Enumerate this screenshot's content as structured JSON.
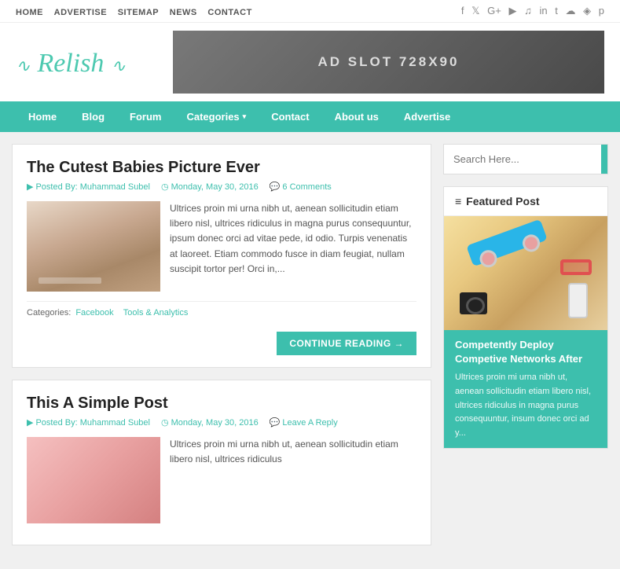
{
  "topNav": {
    "items": [
      "HOME",
      "ADVERTISE",
      "SITEMAP",
      "NEWS",
      "CONTACT"
    ]
  },
  "socialIcons": [
    "f",
    "y",
    "G+",
    "▶",
    "☁",
    "in",
    "t",
    "☁",
    "📷",
    "p"
  ],
  "logo": {
    "text": "Relish",
    "prefix": "~",
    "suffix": "~"
  },
  "adSlot": {
    "text": "AD SLOT 728X90"
  },
  "mainNav": {
    "items": [
      {
        "label": "Home",
        "hasDropdown": false
      },
      {
        "label": "Blog",
        "hasDropdown": false
      },
      {
        "label": "Forum",
        "hasDropdown": false
      },
      {
        "label": "Categories",
        "hasDropdown": true
      },
      {
        "label": "Contact",
        "hasDropdown": false
      },
      {
        "label": "About us",
        "hasDropdown": false
      },
      {
        "label": "Advertise",
        "hasDropdown": false
      }
    ]
  },
  "posts": [
    {
      "title": "The Cutest Babies Picture Ever",
      "author": "Posted By: Muhammad Subel",
      "date": "Monday, May 30, 2016",
      "comments": "6 Comments",
      "excerpt": "Ultrices proin mi urna nibh ut, aenean sollicitudin etiam libero nisl, ultrices ridiculus in magna purus consequuntur, ipsum donec orci ad vitae pede, id odio. Turpis venenatis at laoreet. Etiam commodo fusce in diam feugiat, nullam suscipit tortor per! Orci in,...",
      "categories": "Categories: Facebook  Tools & Analytics",
      "continueBtn": "CONTINUE READING →"
    },
    {
      "title": "This A Simple Post",
      "author": "Posted By: Muhammad Subel",
      "date": "Monday, May 30, 2016",
      "comments": "Leave A Reply",
      "excerpt": "Ultrices proin mi urna nibh ut, aenean sollicitudin etiam libero nisl, ultrices ridiculus"
    }
  ],
  "sidebar": {
    "searchPlaceholder": "Search Here...",
    "searchBtn": "🔍",
    "featuredPost": {
      "title": "Featured Post",
      "featuredTitle": "Competently Deploy Competive Networks After",
      "featuredText": "Ultrices proin mi urna nibh ut, aenean sollicitudin etiam libero nisl, ultrices ridiculus in magna purus consequuntur, insum donec orci ad y..."
    }
  }
}
